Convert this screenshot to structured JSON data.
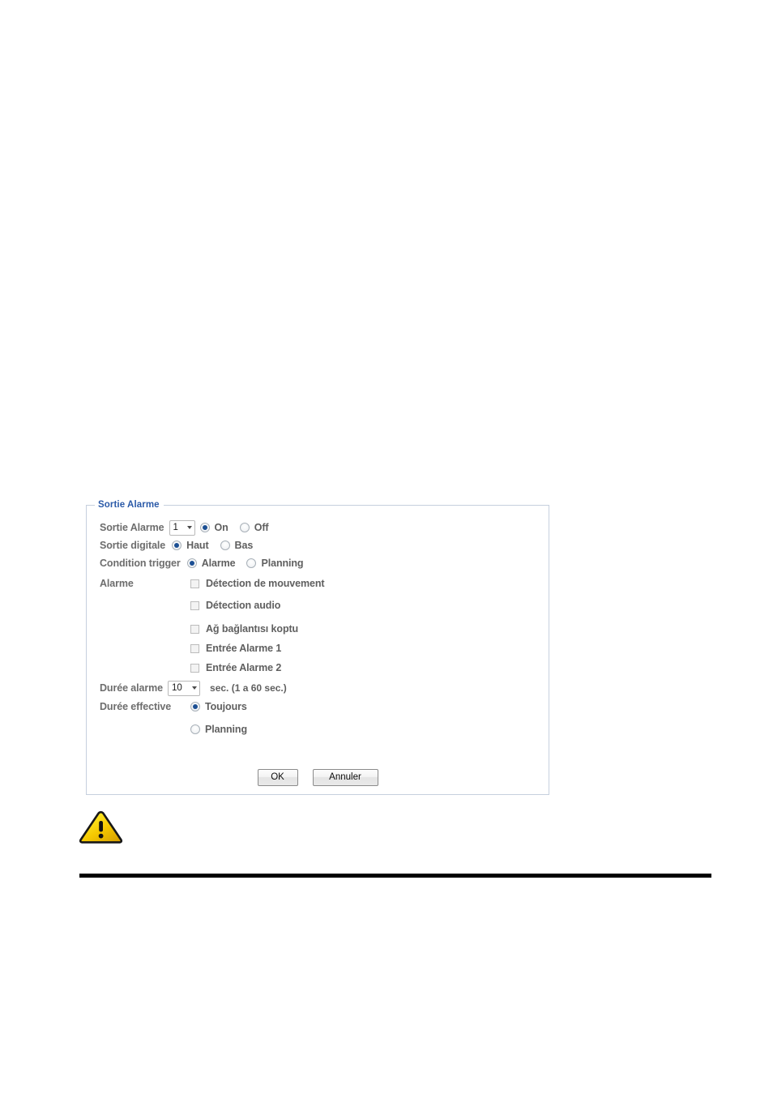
{
  "panel": {
    "legend": "Sortie Alarme",
    "rows": {
      "alarm_output": {
        "label": "Sortie Alarme",
        "select_value": "1",
        "options": [
          {
            "label": "On",
            "checked": true
          },
          {
            "label": "Off",
            "checked": false
          }
        ]
      },
      "digital_output": {
        "label": "Sortie digitale",
        "options": [
          {
            "label": "Haut",
            "checked": true
          },
          {
            "label": "Bas",
            "checked": false
          }
        ]
      },
      "trigger_condition": {
        "label": "Condition trigger",
        "options": [
          {
            "label": "Alarme",
            "checked": true
          },
          {
            "label": "Planning",
            "checked": false
          }
        ]
      },
      "alarm": {
        "label": "Alarme",
        "checkboxes": [
          {
            "label": "Détection de mouvement",
            "checked": false
          },
          {
            "label": "Détection audio",
            "checked": false
          },
          {
            "label": "Ağ bağlantısı koptu",
            "checked": false
          },
          {
            "label": "Entrée Alarme 1",
            "checked": false
          },
          {
            "label": "Entrée Alarme 2",
            "checked": false
          }
        ]
      },
      "alarm_duration": {
        "label": "Durée alarme",
        "select_value": "10",
        "hint": "sec. (1 a 60 sec.)"
      },
      "effective_duration": {
        "label": "Durée effective",
        "options": [
          {
            "label": "Toujours",
            "checked": true
          },
          {
            "label": "Planning",
            "checked": false
          }
        ]
      }
    },
    "buttons": {
      "ok": "OK",
      "cancel": "Annuler"
    }
  },
  "icons": {
    "warning": "warning-triangle-icon"
  },
  "colors": {
    "legend_blue": "#2b5aa8",
    "label_gray": "#5f5f5f",
    "panel_border": "#c6d0de",
    "radio_fill": "#1c4f93",
    "warning_yellow": "#f5d600",
    "rule_black": "#000000"
  }
}
